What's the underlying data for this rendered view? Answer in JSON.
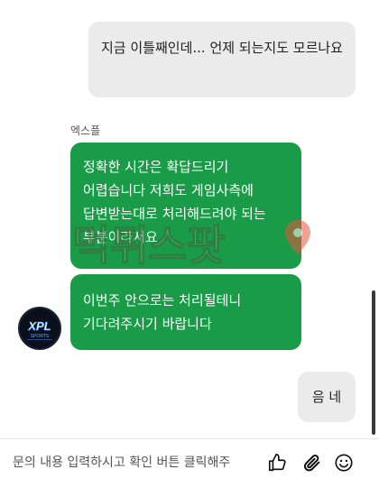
{
  "messages": [
    {
      "sender": "user",
      "text": "지금 이틀째인데... 언제 되는지도 모르나요"
    },
    {
      "sender": "agent",
      "name": "엑스플",
      "text": "정확한 시간은 확답드리기 어렵습니다 저희도 게임사측에 답변받는대로 처리해드려야 되는 부분이라서요"
    },
    {
      "sender": "agent",
      "text": "이번주 안으로는 처리될테니 기다려주시기 바랍니다"
    },
    {
      "sender": "user",
      "text": "음 네"
    }
  ],
  "agent": {
    "name": "엑스플",
    "avatar_text": "XPL",
    "avatar_sub": "SPORTS"
  },
  "watermark": {
    "text": "먹튀스팟"
  },
  "input": {
    "placeholder": "문의 내용 입력하시고 확인 버튼 클릭해주"
  },
  "icons": {
    "like": "thumbs-up-icon",
    "attach": "paperclip-icon",
    "emoji": "smiley-icon"
  },
  "colors": {
    "agent_bubble": "#1a9b47",
    "user_bubble": "#ebebeb"
  }
}
